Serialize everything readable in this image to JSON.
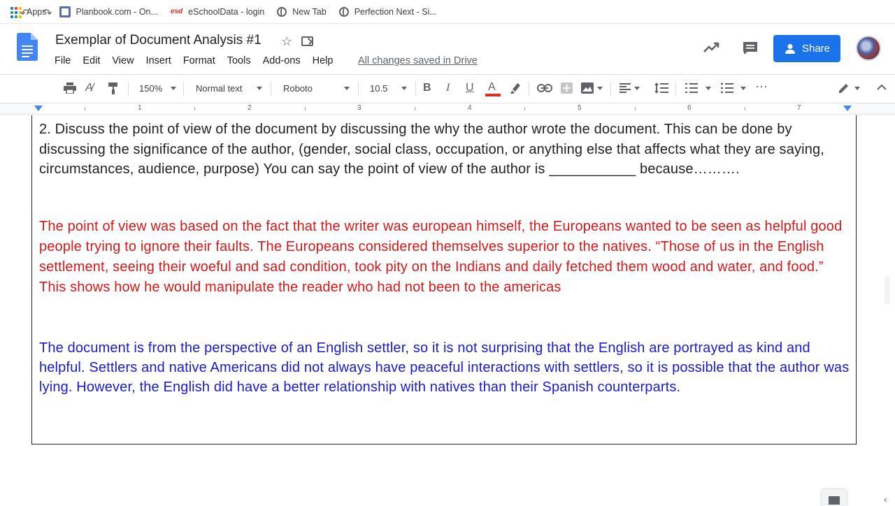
{
  "bookmarks": [
    {
      "label": "Apps",
      "icon": "apps-grid-icon"
    },
    {
      "label": "Planbook.com - On...",
      "icon": "planbook-icon"
    },
    {
      "label": "eSchoolData - login",
      "icon": "esd-icon",
      "icon_text": "esd"
    },
    {
      "label": "New Tab",
      "icon": "globe-icon"
    },
    {
      "label": "Perfection Next - Si...",
      "icon": "globe-icon"
    }
  ],
  "header": {
    "doc_title": "Exemplar of Document Analysis #1",
    "saved_status": "All changes saved in Drive",
    "share_label": "Share"
  },
  "menu": [
    "File",
    "Edit",
    "View",
    "Insert",
    "Format",
    "Tools",
    "Add-ons",
    "Help"
  ],
  "toolbar": {
    "zoom": "150%",
    "style": "Normal text",
    "font": "Roboto",
    "font_size": "10.5",
    "bold": "B",
    "italic": "I",
    "underline": "U",
    "text_color": "A",
    "more": "⋯"
  },
  "ruler": {
    "numbers": [
      "1",
      "2",
      "3",
      "4",
      "5",
      "6",
      "7"
    ]
  },
  "document": {
    "question": "2.  Discuss the point of view of the document by discussing the why the author wrote the document.  This can be done by discussing the significance of the author, (gender, social class, occupation, or anything else that affects what they are saying, circumstances, audience, purpose)  You can say the point of view of the author is ___________ because……….",
    "red_answer": "The point of view was based on the fact that the writer was european himself, the Europeans wanted to be seen as helpful good people trying to ignore their faults. The Europeans considered themselves superior to the natives. “Those of us in the English settlement, seeing their woeful and sad condition, took pity on the Indians and daily fetched them wood and water, and food.” This shows how he would manipulate the reader who had not been to the americas",
    "blue_answer": "The document is from the perspective of an English settler, so it is not surprising that the English are portrayed as kind and helpful. Settlers and native Americans did not always have peaceful interactions with settlers, so it is possible that the author was lying. However, the English did have a better relationship with natives than their Spanish counterparts."
  },
  "colors": {
    "accent": "#1a73e8",
    "red_text": "#d51818",
    "blue_text": "#1a1ad0"
  }
}
